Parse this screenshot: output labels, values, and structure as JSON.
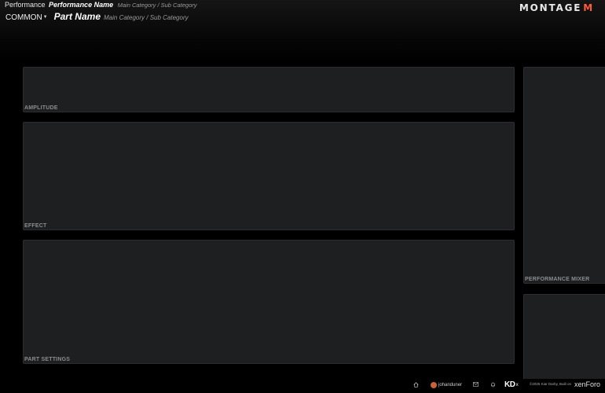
{
  "header": {
    "performance_label": "Performance",
    "performance_name": "Performance Name",
    "performance_category": "Main Category / Sub Category",
    "part_selector": "COMMON",
    "part_name": "Part Name",
    "part_category": "Main Category / Sub Category",
    "logo_text": "MONTAGE",
    "logo_suffix": "M"
  },
  "panels": {
    "amplitude": "AMPLITUDE",
    "effect": "EFFECT",
    "part_settings": "PART SETTINGS",
    "performance_mixer": "PERFORMANCE MIXER"
  },
  "footer": {
    "username": "johanduner",
    "brand": "KD",
    "brand_suffix": "x",
    "copyright": "©2025 Kiar Darby, Built on",
    "platform": "xenForo"
  },
  "colors": {
    "background": "#000000",
    "panel": "#1d1f21",
    "panel_label": "#8a8c8f",
    "logo_accent": "#ff5a3c",
    "avatar": "#c8623a"
  },
  "icons": {
    "home": "home-icon",
    "mail": "mail-icon",
    "bell": "bell-icon",
    "chevron": "chevron-down-icon"
  }
}
